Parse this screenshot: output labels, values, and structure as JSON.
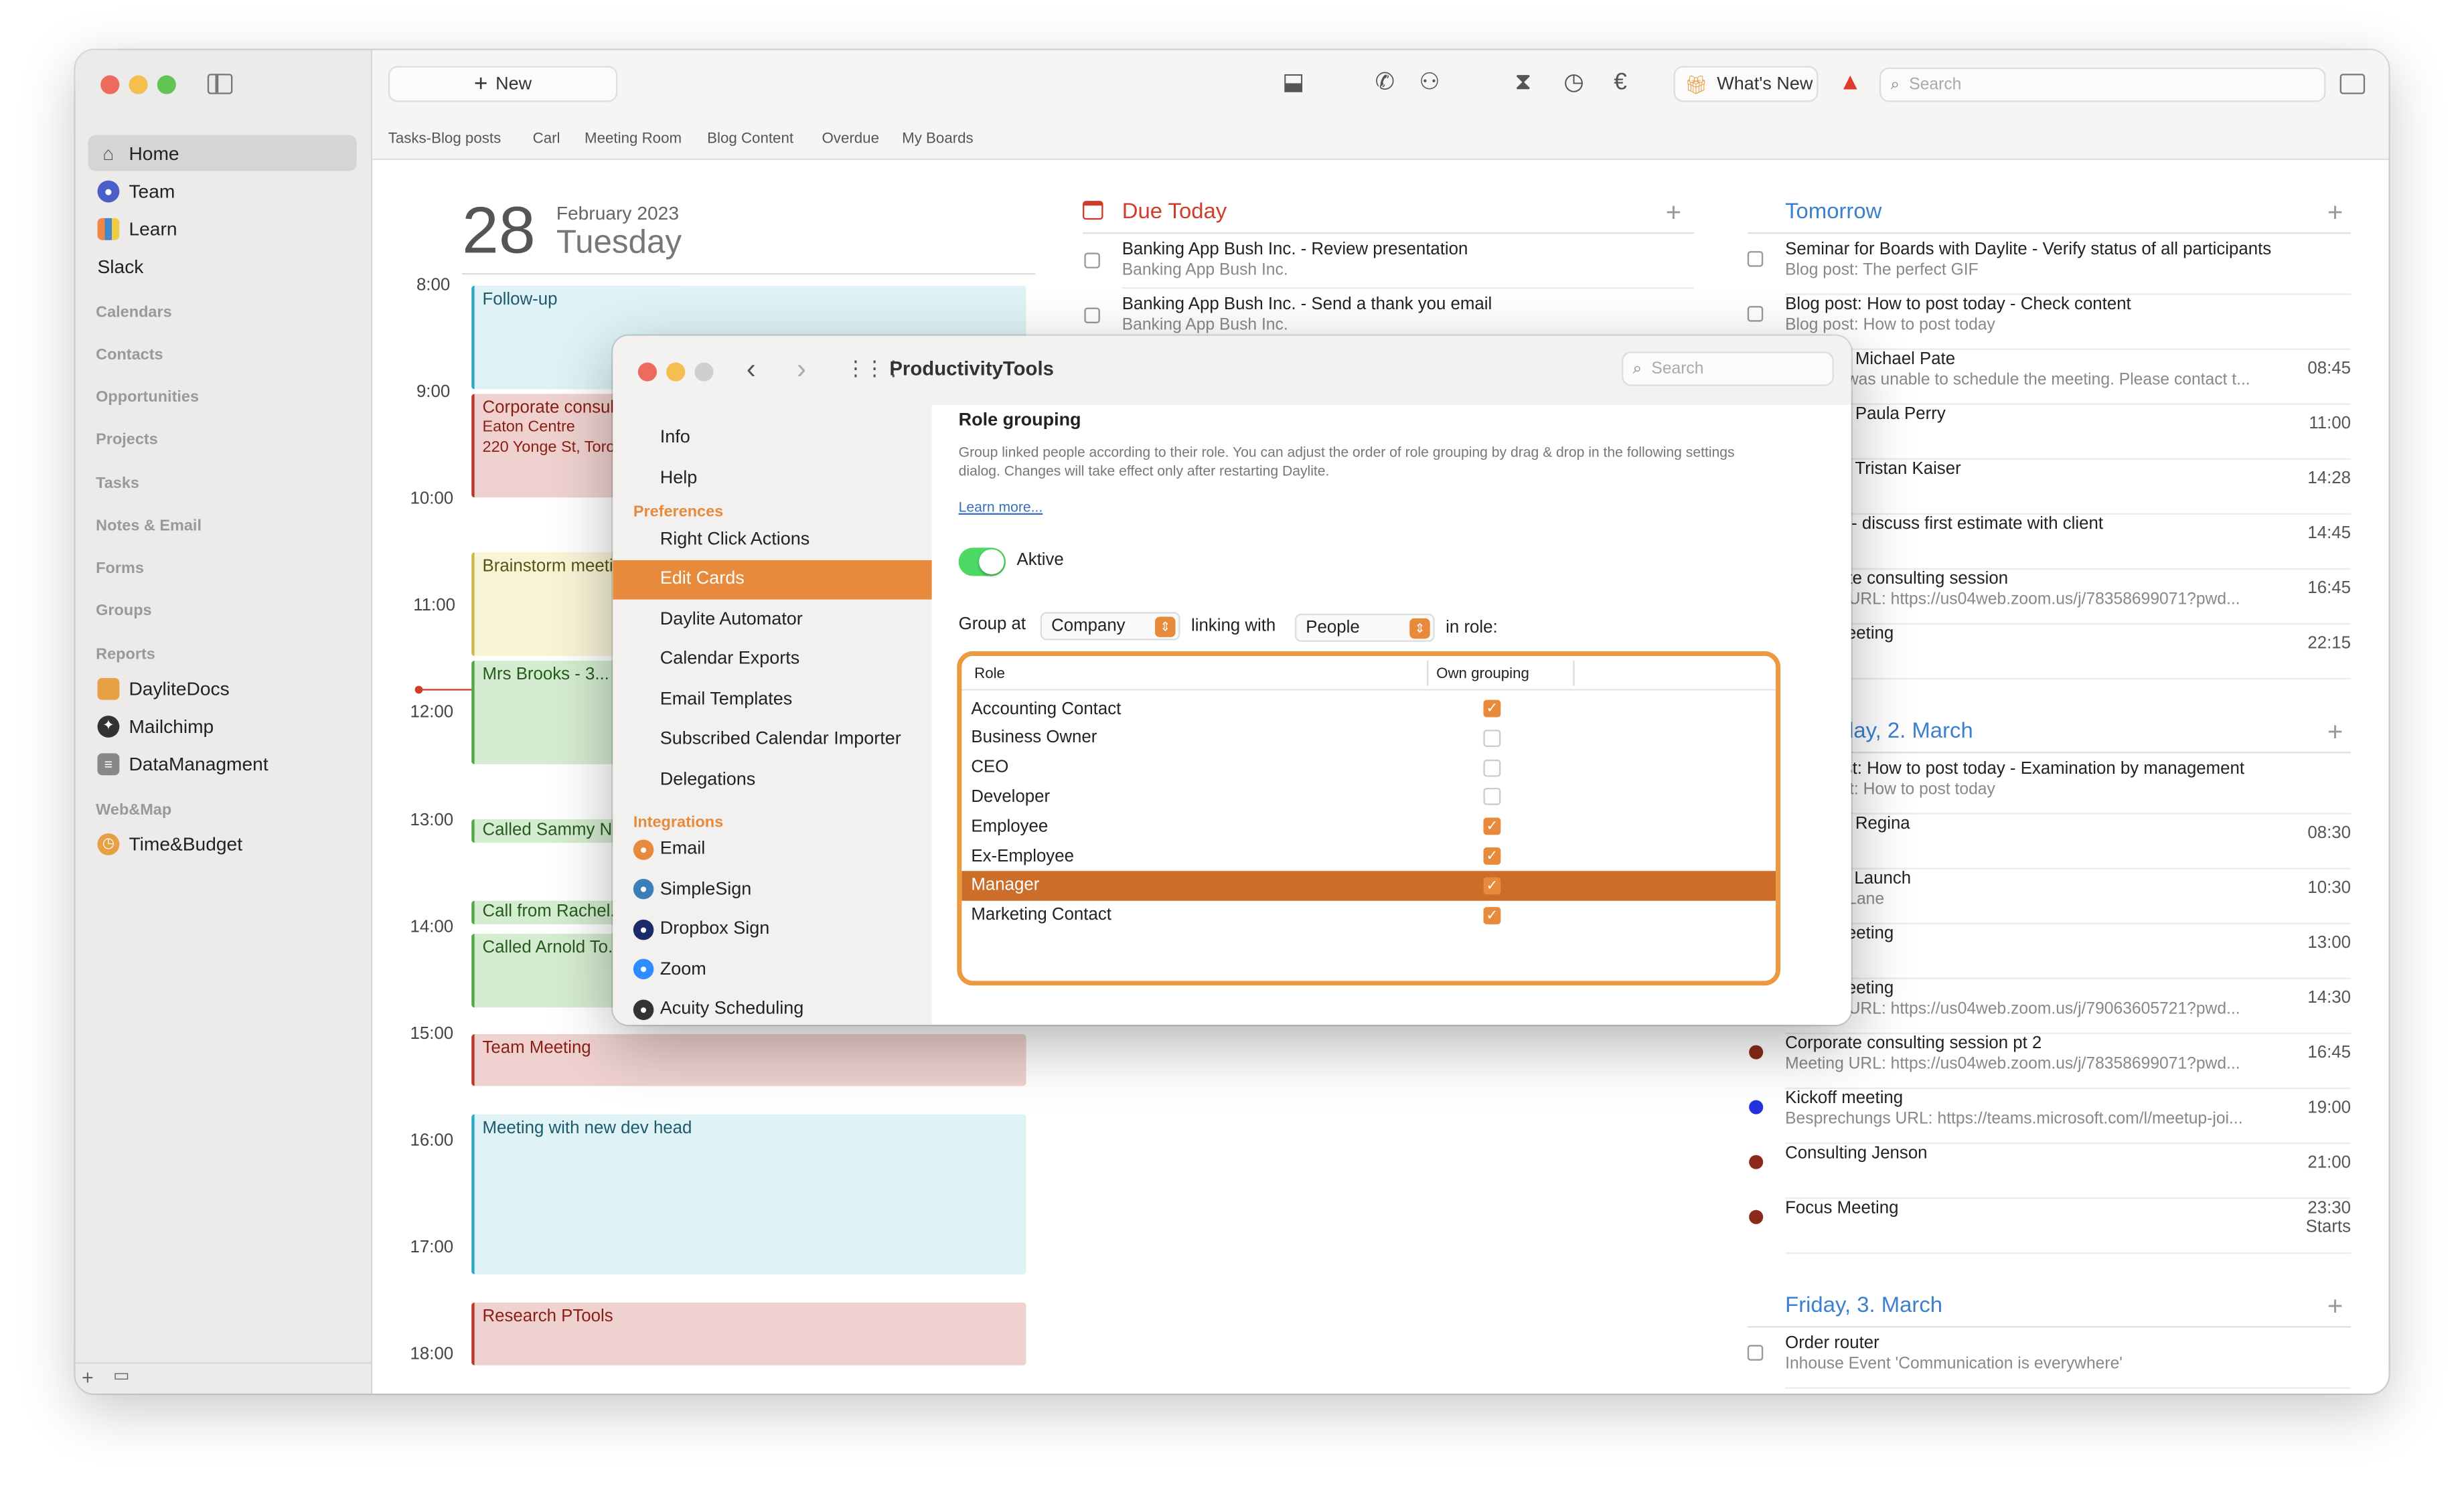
{
  "toolbar": {
    "new_label": "New",
    "whats_new": "What's New",
    "search_placeholder": "Search"
  },
  "tabs": [
    "Tasks-Blog posts",
    "Carl",
    "Meeting Room",
    "Blog Content",
    "Overdue",
    "My Boards"
  ],
  "sidebar": {
    "items": [
      {
        "label": "Home",
        "icon": "home-icon",
        "selected": true
      },
      {
        "label": "Team",
        "icon": "team-icon"
      },
      {
        "label": "Learn",
        "icon": "books-icon"
      },
      {
        "label": "Slack",
        "icon": ""
      }
    ],
    "sections": [
      "Calendars",
      "Contacts",
      "Opportunities",
      "Projects",
      "Tasks",
      "Notes & Email",
      "Forms",
      "Groups",
      "Reports"
    ],
    "reports": [
      {
        "label": "DayliteDocs",
        "icon": "folder-icon"
      },
      {
        "label": "Mailchimp",
        "icon": "mailchimp-icon"
      },
      {
        "label": "DataManagment",
        "icon": "database-icon"
      }
    ],
    "webmap_header": "Web&Map",
    "webmap": [
      {
        "label": "Time&Budget",
        "icon": "timebudget-icon"
      }
    ]
  },
  "day": {
    "number": "28",
    "month": "February 2023",
    "weekday": "Tuesday"
  },
  "hours": [
    "8:00",
    "9:00",
    "10:00",
    "11:00",
    "12:00",
    "13:00",
    "14:00",
    "15:00",
    "16:00",
    "17:00",
    "18:00"
  ],
  "events": [
    {
      "title": "Follow-up",
      "sub1": "",
      "sub2": "",
      "color": "#2fa8c4",
      "bg": "#dff3f7",
      "text": "#1a5a6a"
    },
    {
      "title": "Corporate consulting session",
      "sub1": "Eaton Centre",
      "sub2": "220 Yonge St, Toronto",
      "color": "#b83a2e",
      "bg": "#efd2cf",
      "text": "#8a1d14"
    },
    {
      "title": "Brainstorm meeting",
      "sub1": "",
      "sub2": "",
      "color": "#c9b94a",
      "bg": "#f8f4d6",
      "text": "#5b5114"
    },
    {
      "title": "Mrs Brooks - 3...",
      "sub1": "",
      "sub2": "",
      "color": "#52a845",
      "bg": "#d4ecd0",
      "text": "#265a1e"
    },
    {
      "title": "Called Sammy N...",
      "sub1": "",
      "sub2": "",
      "color": "#52a845",
      "bg": "#d4ecd0",
      "text": "#265a1e"
    },
    {
      "title": "Call from Rachel...",
      "sub1": "",
      "sub2": "",
      "color": "#52a845",
      "bg": "#d4ecd0",
      "text": "#265a1e"
    },
    {
      "title": "Called Arnold To...",
      "sub1": "",
      "sub2": "",
      "color": "#52a845",
      "bg": "#d4ecd0",
      "text": "#265a1e"
    },
    {
      "title": "Team Meeting",
      "sub1": "",
      "sub2": "",
      "color": "#b83a2e",
      "bg": "#efd2cf",
      "text": "#8a1d14"
    },
    {
      "title": "Meeting with new dev head",
      "sub1": "",
      "sub2": "",
      "color": "#2fa8c4",
      "bg": "#dff3f7",
      "text": "#1a5a6a"
    },
    {
      "title": "Research PTools",
      "sub1": "",
      "sub2": "",
      "color": "#b83a2e",
      "bg": "#efd2cf",
      "text": "#8a1d14"
    }
  ],
  "due_today": {
    "title": "Due Today",
    "tasks": [
      {
        "title": "Banking App Bush Inc. - Review presentation",
        "sub": "Banking App Bush Inc."
      },
      {
        "title": "Banking App Bush Inc. - Send a thank you email",
        "sub": "Banking App Bush Inc."
      }
    ]
  },
  "tomorrow": {
    "title": "Tomorrow",
    "rows": [
      {
        "title": "Seminar for Boards with Daylite - Verify status of all participants",
        "sub": "Blog post: The perfect GIF",
        "time": "",
        "kind": "check"
      },
      {
        "title": "Blog post: How to post today - Check content",
        "sub": "Blog post: How to post today",
        "time": "",
        "kind": "check"
      },
      {
        "title": "Call with Michael Pate",
        "sub": "Michael was unable to schedule the meeting.  Please contact t...",
        "time": "08:45",
        "kind": "dot"
      },
      {
        "title": "Call with Paula Perry",
        "sub": "",
        "time": "11:00",
        "kind": "dot"
      },
      {
        "title": "Call with Tristan Kaiser",
        "sub": "",
        "time": "14:28",
        "kind": "dot"
      },
      {
        "title": "Meeting - discuss first estimate with client",
        "sub": "",
        "time": "14:45",
        "kind": "dot"
      },
      {
        "title": "Corporate consulting session",
        "sub": "Meeting URL: https://us04web.zoom.us/j/78358699071?pwd...",
        "time": "16:45",
        "kind": "dot"
      },
      {
        "title": "Team Meeting",
        "sub": "",
        "time": "22:15",
        "kind": "dot"
      }
    ]
  },
  "thursday": {
    "title": "Thursday, 2. March",
    "rows": [
      {
        "title": "Blog post: How to post today - Examination by management",
        "sub": "Blog post: How to post today",
        "time": "",
        "kind": "check"
      },
      {
        "title": "Call with Regina",
        "sub": "",
        "time": "08:30",
        "kind": "dot"
      },
      {
        "title": "Design - Launch",
        "sub": "Orleans Lane",
        "time": "10:30",
        "kind": "dot"
      },
      {
        "title": "Team Meeting",
        "sub": "",
        "time": "13:00",
        "kind": "dot"
      },
      {
        "title": "Team Meeting",
        "sub": "Meeting URL: https://us04web.zoom.us/j/79063605721?pwd...",
        "time": "14:30",
        "kind": "dot"
      },
      {
        "title": "Corporate consulting session pt 2",
        "sub": "Meeting URL: https://us04web.zoom.us/j/78358699071?pwd...",
        "time": "16:45",
        "kind": "dot",
        "color": "#8b2a1a"
      },
      {
        "title": "Kickoff meeting",
        "sub": "Besprechungs URL: https://teams.microsoft.com/l/meetup-joi...",
        "time": "19:00",
        "kind": "dot",
        "color": "#2233dd"
      },
      {
        "title": "Consulting Jenson",
        "sub": "",
        "time": "21:00",
        "kind": "dot",
        "color": "#8b2a1a"
      },
      {
        "title": "Focus Meeting",
        "sub": "",
        "time": "23:30",
        "time2": "Starts",
        "kind": "dot",
        "color": "#8b2a1a"
      }
    ]
  },
  "friday": {
    "title": "Friday, 3. March",
    "rows": [
      {
        "title": "Order router",
        "sub": "Inhouse Event 'Communication is everywhere'",
        "kind": "check"
      }
    ]
  },
  "dialog": {
    "title": "ProductivityTools",
    "search_placeholder": "Search",
    "nav_top": [
      "Info",
      "Help"
    ],
    "preferences_header": "Preferences",
    "preferences": [
      "Right Click Actions",
      "Edit Cards",
      "Daylite Automator",
      "Calendar Exports",
      "Email Templates",
      "Subscribed Calendar Importer",
      "Delegations"
    ],
    "selected_pref": "Edit Cards",
    "integrations_header": "Integrations",
    "integrations": [
      {
        "label": "Email",
        "icon": "email-icon",
        "color": "#e88a3c"
      },
      {
        "label": "SimpleSign",
        "icon": "simplesign-icon",
        "color": "#3b7fb8"
      },
      {
        "label": "Dropbox Sign",
        "icon": "dropbox-sign-icon",
        "color": "#1a2a6a"
      },
      {
        "label": "Zoom",
        "icon": "zoom-icon",
        "color": "#2d8cff"
      },
      {
        "label": "Acuity Scheduling",
        "icon": "acuity-icon",
        "color": "#333333"
      }
    ],
    "section_title": "Role grouping",
    "description": "Group linked people according to their role. You can adjust the order of role grouping by drag & drop in the following settings dialog. Changes will take effect only after restarting Daylite.",
    "learn_more": "Learn more...",
    "toggle_label": "Aktive",
    "group_at_label": "Group at",
    "group_at_value": "Company",
    "linking_with_label": "linking with",
    "linking_with_value": "People",
    "in_role_label": "in role:",
    "table_headers": [
      "Role",
      "Own grouping"
    ],
    "roles": [
      {
        "name": "Accounting Contact",
        "checked": true
      },
      {
        "name": "Business Owner",
        "checked": false
      },
      {
        "name": "CEO",
        "checked": false
      },
      {
        "name": "Developer",
        "checked": false
      },
      {
        "name": "Employee",
        "checked": true
      },
      {
        "name": "Ex-Employee",
        "checked": true
      },
      {
        "name": "Manager",
        "checked": true,
        "selected": true
      },
      {
        "name": "Marketing Contact",
        "checked": true
      }
    ]
  },
  "colors": {
    "accent": "#e88a3c",
    "due": "#d23a2a",
    "tomorrow": "#3a7fd0"
  }
}
